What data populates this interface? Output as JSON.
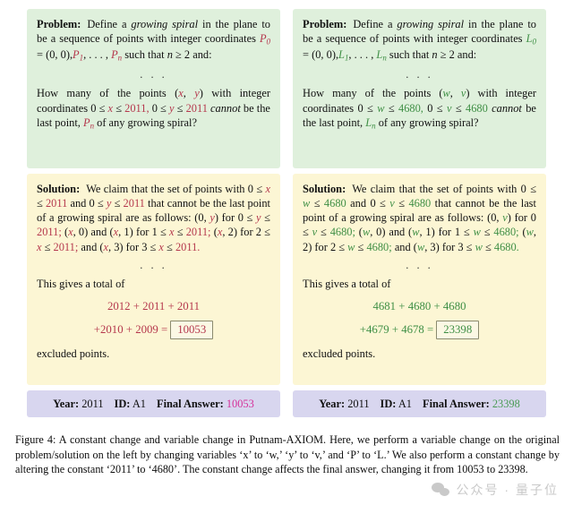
{
  "figure": {
    "caption": "Figure 4: A constant change and variable change in Putnam-AXIOM. Here, we perform a variable change on the original problem/solution on the left by changing variables ‘x’ to ‘w,’ ‘y’ to ‘v,’ and ‘P’ to ‘L.’ We also perform a constant change by altering the constant ‘2011’ to ‘4680’. The constant change affects the final answer, changing it from 10053 to 23398.",
    "caption_label": "Figure 4:"
  },
  "left": {
    "problem": {
      "lead": "Problem:",
      "t1": "Define a",
      "i1": "growing spiral",
      "t2": "in the plane to be a sequence of points with integer coordinates",
      "p0": "P",
      "p0sub": "0",
      "eq": "=",
      "origin": "(0, 0),",
      "p1": "P",
      "p1sub": "1",
      "dots": ", . . . ,",
      "pn": "P",
      "pnsub": "n",
      "t3": "such that",
      "n": "n",
      "ge2": "≥ 2 and:",
      "ellipsis": ". . .",
      "t4": "How many of the points",
      "pt_open": "(",
      "pt_x": "x",
      "pt_comma": ",",
      "pt_y": "y",
      "pt_close": ")",
      "t5": "with integer coordinates",
      "ineq1_a": "0 ≤",
      "ineq1_x": "x",
      "ineq1_b": "≤",
      "ineq1_n": "2011,",
      "ineq2_a": "0 ≤",
      "ineq2_y": "y",
      "ineq2_b": "≤",
      "ineq2_n": "2011",
      "t6": "cannot",
      "t7": "be the last point,",
      "pn2": "P",
      "pn2sub": "n",
      "t8": "of any growing spiral?"
    },
    "solution": {
      "lead": "Solution:",
      "t1": "We claim that the set of points with",
      "r1a": "0 ≤",
      "r1x": "x",
      "r1b": "≤",
      "r1n": "2011",
      "and1": "and",
      "r2a": "0 ≤",
      "r2y": "y",
      "r2b": "≤",
      "r2n": "2011",
      "t2": "that cannot be the last point of a growing spiral are as follows:",
      "s1": "(0,",
      "s1v": "y",
      "s1c": ") for 0 ≤",
      "s1v2": "y",
      "s1d": "≤",
      "s1n": "2011;",
      "s2": "(",
      "s2v": "x",
      "s2c": ", 0) and (",
      "s2v2": "x",
      "s2d": ", 1) for 1 ≤",
      "s2v3": "x",
      "s2e": "≤",
      "s2n": "2011;",
      "s3": "(",
      "s3v": "x",
      "s3c": ", 2) for 2 ≤",
      "s3v2": "x",
      "s3d": "≤",
      "s3n": "2011;",
      "s4": "and (",
      "s4v": "x",
      "s4c": ", 3) for 3 ≤",
      "s4v2": "x",
      "s4d": "≤",
      "s4n": "2011.",
      "ellipsis": ". . .",
      "total_intro": "This gives a total of",
      "sum_line1": "2012 + 2011 + 2011",
      "sum_line2_pre": "+2010 + 2009 =",
      "boxed_answer": "10053",
      "excluded": "excluded points."
    },
    "meta": {
      "year_label": "Year:",
      "year_value": "2011",
      "id_label": "ID:",
      "id_value": "A1",
      "answer_label": "Final Answer:",
      "answer_value": "10053"
    }
  },
  "right": {
    "problem": {
      "lead": "Problem:",
      "t1": "Define a",
      "i1": "growing spiral",
      "t2": "in the plane to be a sequence of points with integer coordinates",
      "p0": "L",
      "p0sub": "0",
      "eq": "=",
      "origin": "(0, 0),",
      "p1": "L",
      "p1sub": "1",
      "dots": ", . . . ,",
      "pn": "L",
      "pnsub": "n",
      "t3": "such that",
      "n": "n",
      "ge2": "≥ 2 and:",
      "ellipsis": ". . .",
      "t4": "How many of the points",
      "pt_open": "(",
      "pt_x": "w",
      "pt_comma": ",",
      "pt_y": "v",
      "pt_close": ")",
      "t5": "with integer coordinates",
      "ineq1_a": "0 ≤",
      "ineq1_x": "w",
      "ineq1_b": "≤",
      "ineq1_n": "4680,",
      "ineq2_a": "0 ≤",
      "ineq2_y": "v",
      "ineq2_b": "≤",
      "ineq2_n": "4680",
      "t6": "cannot",
      "t7": "be the last point,",
      "pn2": "L",
      "pn2sub": "n",
      "t8": "of any growing spiral?"
    },
    "solution": {
      "lead": "Solution:",
      "t1": "We claim that the set of points with",
      "r1a": "0 ≤",
      "r1x": "w",
      "r1b": "≤",
      "r1n": "4680",
      "and1": "and",
      "r2a": "0 ≤",
      "r2y": "v",
      "r2b": "≤",
      "r2n": "4680",
      "t2": "that cannot be the last point of a growing spiral are as follows:",
      "s1": "(0,",
      "s1v": "v",
      "s1c": ") for 0 ≤",
      "s1v2": "v",
      "s1d": "≤",
      "s1n": "4680;",
      "s2": "(",
      "s2v": "w",
      "s2c": ", 0) and (",
      "s2v2": "w",
      "s2d": ", 1) for 1 ≤",
      "s2v3": "w",
      "s2e": "≤",
      "s2n": "4680;",
      "s3": "(",
      "s3v": "w",
      "s3c": ", 2) for 2 ≤",
      "s3v2": "w",
      "s3d": "≤",
      "s3n": "4680;",
      "s4": "and (",
      "s4v": "w",
      "s4c": ", 3) for 3 ≤",
      "s4v2": "w",
      "s4d": "≤",
      "s4n": "4680.",
      "ellipsis": ". . .",
      "total_intro": "This gives a total of",
      "sum_line1": "4681 + 4680 + 4680",
      "sum_line2_pre": "+4679 + 4678 =",
      "boxed_answer": "23398",
      "excluded": "excluded points."
    },
    "meta": {
      "year_label": "Year:",
      "year_value": "2011",
      "id_label": "ID:",
      "id_value": "A1",
      "answer_label": "Final Answer:",
      "answer_value": "23398"
    }
  },
  "watermark": {
    "text": "公众号 · 量子位",
    "icon": "wechat-icon"
  },
  "colors": {
    "problem_bg": "#dff0dc",
    "solution_bg": "#fcf6d4",
    "meta_bg": "#d8d6ef",
    "red_accent": "#b5384d",
    "green_accent": "#3f8f45",
    "pink_answer": "#d6309a",
    "green_answer": "#4a9b55"
  }
}
